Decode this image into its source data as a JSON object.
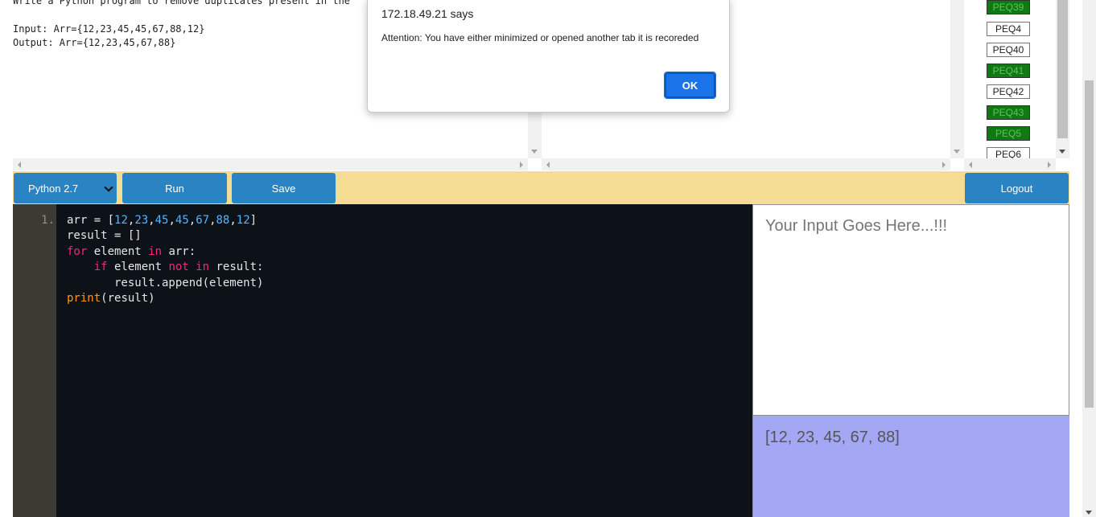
{
  "question": {
    "line1": "Write a Python program to remove duplicates present in the",
    "line2": "Input: Arr={12,23,45,45,67,88,12}",
    "line3": "Output: Arr={12,23,45,67,88}"
  },
  "alert": {
    "origin": "172.18.49.21 says",
    "message": "Attention: You have either minimized or opened another tab it is recoreded",
    "ok_label": "OK"
  },
  "question_list": [
    {
      "label": "PEQ39",
      "status": "done"
    },
    {
      "label": "PEQ4",
      "status": "pending"
    },
    {
      "label": "PEQ40",
      "status": "pending"
    },
    {
      "label": "PEQ41",
      "status": "done"
    },
    {
      "label": "PEQ42",
      "status": "pending"
    },
    {
      "label": "PEQ43",
      "status": "done"
    },
    {
      "label": "PEQ5",
      "status": "done"
    },
    {
      "label": "PEQ6",
      "status": "pending"
    }
  ],
  "toolbar": {
    "language": "Python 2.7",
    "run_label": "Run",
    "save_label": "Save",
    "logout_label": "Logout"
  },
  "editor": {
    "line_number": "1.",
    "code_lines": [
      "arr = [12,23,45,45,67,88,12]",
      "result = []",
      "for element in arr:",
      "    if element not in result:",
      "       result.append(element)",
      "print(result)"
    ]
  },
  "io": {
    "input_placeholder": "Your Input Goes Here...!!!",
    "output_text": "[12, 23, 45, 67, 88]"
  },
  "colors": {
    "button_blue": "#2a84c4",
    "toolbar_bg": "#f4dc92",
    "editor_bg": "#0d1118",
    "output_bg": "#a4a8f4",
    "done_green": "#0f7a12"
  }
}
